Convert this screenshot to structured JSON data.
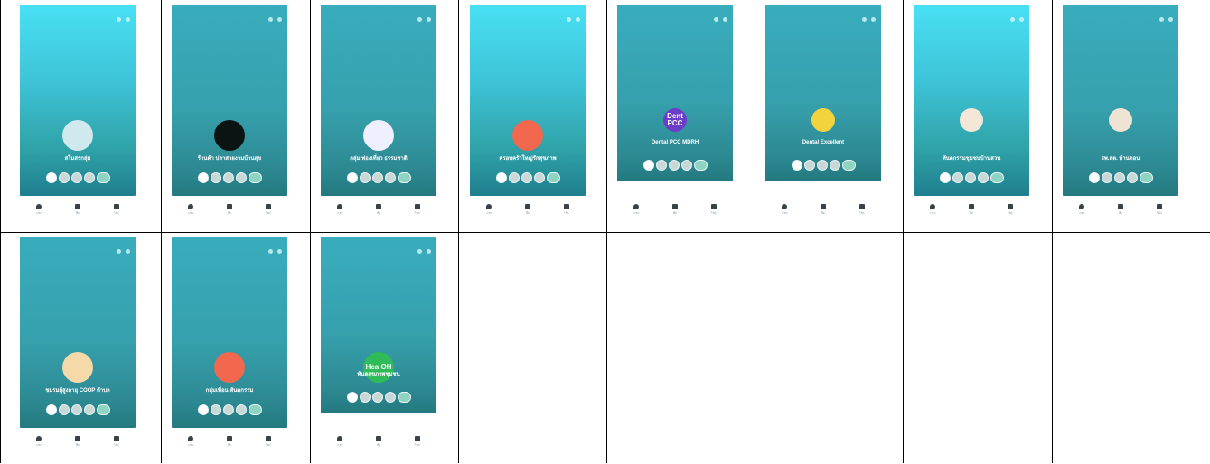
{
  "cells": [
    {
      "name": "สโมสรกลุ่ม",
      "avatar": {
        "color": "#cfe9ef",
        "text": "",
        "icon": "people-icon",
        "small": false
      },
      "members": 4,
      "dark": false,
      "short": false
    },
    {
      "name": "ร้านค้า ปลาสวยงามบ้านสุข",
      "avatar": {
        "color": "#0b1412",
        "text": "",
        "icon": "photo-icon",
        "small": false
      },
      "members": 4,
      "dark": true,
      "short": false
    },
    {
      "name": "กลุ่ม ท่องเที่ยว ธรรมชาติ",
      "avatar": {
        "color": "#eef0ff",
        "text": "",
        "icon": "logo-icon",
        "small": false
      },
      "members": 4,
      "dark": true,
      "short": false
    },
    {
      "name": "ครอบครัวใหญ่รักสุขภาพ",
      "avatar": {
        "color": "#f2684f",
        "text": "",
        "icon": "circle-icon",
        "small": false
      },
      "members": 4,
      "dark": false,
      "short": false
    },
    {
      "name": "Dental PCC MDRH",
      "avatar": {
        "color": "#6c3dc9",
        "text": "Dent PCC",
        "icon": "",
        "small": true
      },
      "members": 4,
      "dark": true,
      "short": true
    },
    {
      "name": "Dental Excellent",
      "avatar": {
        "color": "#f3d33d",
        "text": "",
        "icon": "emoji-icon",
        "small": true
      },
      "members": 4,
      "dark": true,
      "short": true
    },
    {
      "name": "ทันตกรรมชุมชนบ้านสวน",
      "avatar": {
        "color": "#f4e7d8",
        "text": "",
        "icon": "mascot-icon",
        "small": true
      },
      "members": 4,
      "dark": false,
      "short": false
    },
    {
      "name": "รพ.สต. บ้านดอน",
      "avatar": {
        "color": "#efe4d4",
        "text": "",
        "icon": "monk-icon",
        "small": true
      },
      "members": 4,
      "dark": true,
      "short": false
    },
    {
      "name": "ชมรมผู้สูงอายุ COOP ตำบล",
      "avatar": {
        "color": "#f6d9a8",
        "text": "",
        "icon": "cartoon-icon",
        "small": false
      },
      "members": 4,
      "dark": true,
      "short": false
    },
    {
      "name": "กลุ่มเพื่อน ทันตกรรม",
      "avatar": {
        "color": "#f2684f",
        "text": "",
        "icon": "circle-icon",
        "small": false
      },
      "members": 4,
      "dark": true,
      "short": false
    },
    {
      "name": "ทันตสุขภาพชุมชน",
      "avatar": {
        "color": "#2fbb58",
        "text": "Hea OH",
        "icon": "",
        "small": false
      },
      "members": 4,
      "dark": true,
      "short": true
    }
  ],
  "bottom_labels": [
    "แชท",
    "ฟีด",
    "โน้ต"
  ]
}
